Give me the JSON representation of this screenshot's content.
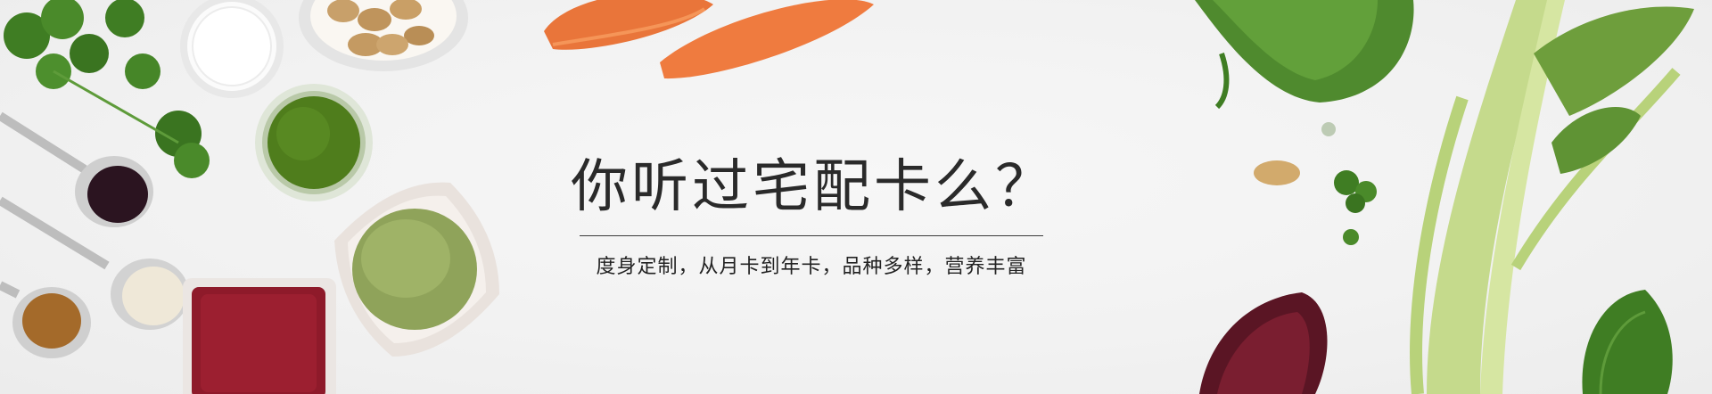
{
  "banner": {
    "title": "你听过宅配卡么？",
    "subtitle": "度身定制，从月卡到年卡，品种多样，营养丰富"
  },
  "colors": {
    "title": "#2a2a2a",
    "subtitle": "#222222",
    "divider": "#3a3a3a",
    "background": "#f2f2f2"
  },
  "decorations": [
    "parsley",
    "milk-glass",
    "almonds-bowl",
    "carrots",
    "green-juice-glass",
    "purple-powder-spoon",
    "flour-spoon",
    "cinnamon-spoon",
    "green-peas-bowl",
    "red-beans-dish",
    "spinach-leaves",
    "almond",
    "parsley-sprig",
    "beetroot",
    "celery",
    "green-leaf"
  ]
}
